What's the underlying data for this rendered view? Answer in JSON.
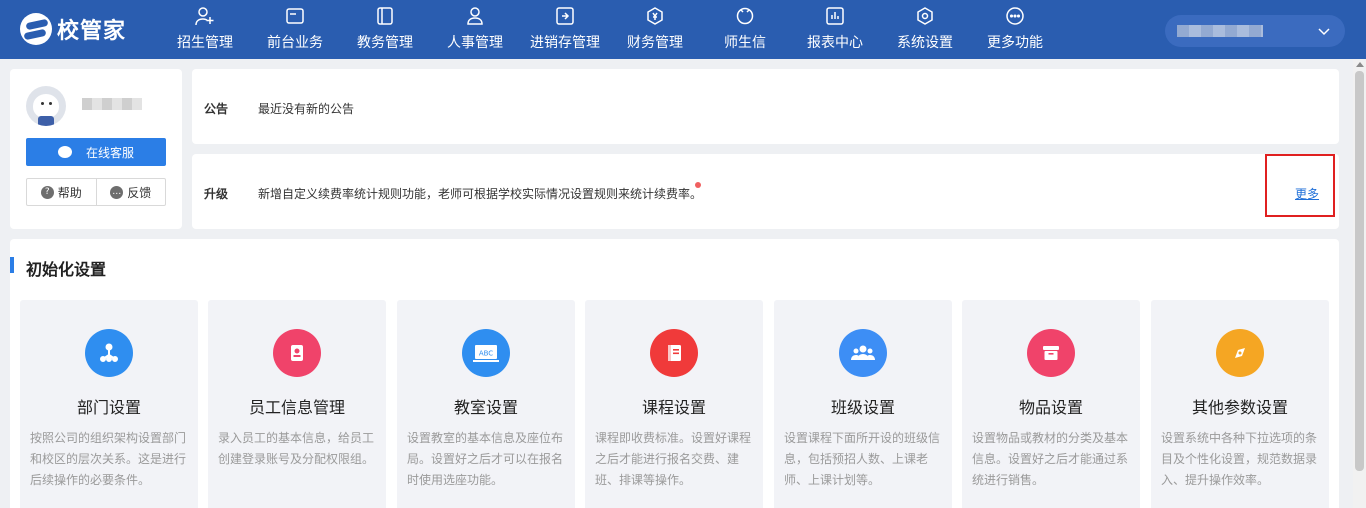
{
  "brand": {
    "name": "校管家"
  },
  "nav": {
    "items": [
      {
        "label": "招生管理",
        "icon": "add-user-icon"
      },
      {
        "label": "前台业务",
        "icon": "desk-icon"
      },
      {
        "label": "教务管理",
        "icon": "book-icon"
      },
      {
        "label": "人事管理",
        "icon": "person-icon"
      },
      {
        "label": "进销存管理",
        "icon": "inventory-icon"
      },
      {
        "label": "财务管理",
        "icon": "finance-icon"
      },
      {
        "label": "师生信",
        "icon": "message-icon"
      },
      {
        "label": "报表中心",
        "icon": "report-icon"
      },
      {
        "label": "系统设置",
        "icon": "settings-icon"
      },
      {
        "label": "更多功能",
        "icon": "more-icon"
      }
    ]
  },
  "profile": {
    "service_label": "在线客服",
    "help_label": "帮助",
    "feedback_label": "反馈"
  },
  "notices": {
    "announcement": {
      "tag": "公告",
      "text": "最近没有新的公告"
    },
    "upgrade": {
      "tag": "升级",
      "text": "新增自定义续费率统计规则功能，老师可根据学校实际情况设置规则来统计续费率。",
      "more_label": "更多"
    }
  },
  "init": {
    "title": "初始化设置",
    "cards": [
      {
        "title": "部门设置",
        "desc": "按照公司的组织架构设置部门和校区的层次关系。这是进行后续操作的必要条件。",
        "icon": "org-tree-icon",
        "color": "#2f8ef0"
      },
      {
        "title": "员工信息管理",
        "desc": "录入员工的基本信息，给员工创建登录账号及分配权限组。",
        "icon": "id-card-icon",
        "color": "#f0436a"
      },
      {
        "title": "教室设置",
        "desc": "设置教室的基本信息及座位布局。设置好之后才可以在报名时使用选座功能。",
        "icon": "classroom-icon",
        "color": "#2f8ef0"
      },
      {
        "title": "课程设置",
        "desc": "课程即收费标准。设置好课程之后才能进行报名交费、建班、排课等操作。",
        "icon": "course-icon",
        "color": "#f03a3a"
      },
      {
        "title": "班级设置",
        "desc": "设置课程下面所开设的班级信息，包括预招人数、上课老师、上课计划等。",
        "icon": "class-group-icon",
        "color": "#3d8ef5"
      },
      {
        "title": "物品设置",
        "desc": "设置物品或教材的分类及基本信息。设置好之后才能通过系统进行销售。",
        "icon": "goods-box-icon",
        "color": "#f0436a"
      },
      {
        "title": "其他参数设置",
        "desc": "设置系统中各种下拉选项的条目及个性化设置，规范数据录入、提升操作效率。",
        "icon": "compass-icon",
        "color": "#f5a623"
      }
    ]
  }
}
